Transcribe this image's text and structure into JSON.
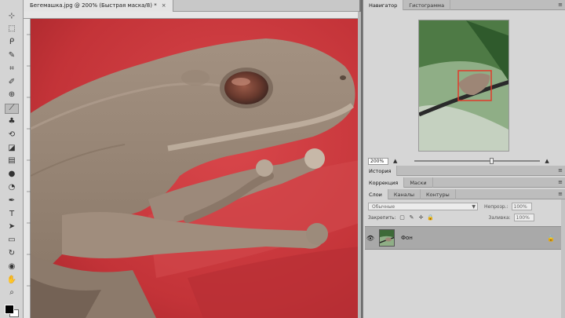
{
  "document": {
    "tab_title": "Бегемашка.jpg @ 200% (Быстрая маска/8) *",
    "tab_close": "×"
  },
  "toolbar": {
    "tools": [
      "move-icon",
      "marquee-icon",
      "lasso-icon",
      "quick-select-icon",
      "crop-icon",
      "eyedropper-icon",
      "healing-icon",
      "brush-icon",
      "clone-stamp-icon",
      "history-brush-icon",
      "eraser-icon",
      "gradient-icon",
      "blur-icon",
      "dodge-icon",
      "pen-icon",
      "type-icon",
      "path-select-icon",
      "shape-icon",
      "3d-rotate-icon",
      "3d-camera-icon",
      "hand-icon",
      "zoom-icon"
    ],
    "glyphs": [
      "⊹",
      "⬚",
      "ᑭ",
      "✎",
      "⌗",
      "✐",
      "⊕",
      "⟋",
      "♣",
      "⟲",
      "◪",
      "▤",
      "●",
      "◔",
      "✒",
      "T",
      "➤",
      "▭",
      "↻",
      "◉",
      "✋",
      "⌕"
    ],
    "active_index": 7
  },
  "navigator": {
    "tabs": [
      "Навигатор",
      "Гистограмма"
    ],
    "menu": "≡",
    "zoom_value": "200%",
    "zoom_fraction": 0.62
  },
  "history": {
    "tabs": [
      "История"
    ],
    "menu": "≡"
  },
  "adjustments": {
    "tabs": [
      "Коррекция",
      "Маски"
    ],
    "menu": "≡"
  },
  "layers": {
    "tabs": [
      "Слои",
      "Каналы",
      "Контуры"
    ],
    "menu": "≡",
    "blend_mode": "Обычные",
    "opacity_label": "Непрозр.:",
    "opacity_value": "100%",
    "lock_label": "Закрепить:",
    "fill_label": "Заливка:",
    "fill_value": "100%",
    "items": [
      {
        "name": "Фон",
        "visible": true,
        "locked": true
      }
    ]
  },
  "colors": {
    "canvas_red": "#c8393e",
    "frog_skin": "#9a8778",
    "panel_bg": "#d6d6d6"
  }
}
